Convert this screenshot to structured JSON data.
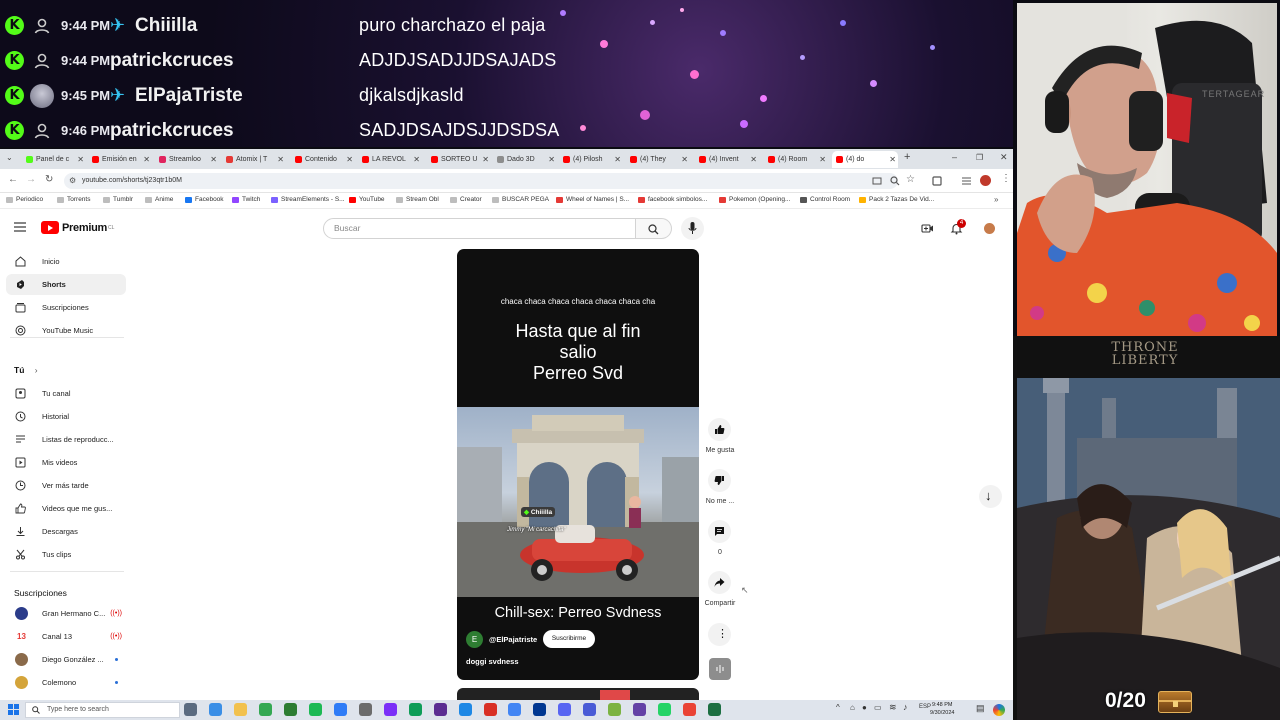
{
  "chat": {
    "messages": [
      {
        "time": "9:44 PM",
        "user": "Chiiilla",
        "message": "puro charchazo el paja",
        "has_sword": true,
        "avatar": "default"
      },
      {
        "time": "9:44 PM",
        "user": "patrickcruces",
        "message": "ADJDJSADJJDSAJADS",
        "has_sword": false,
        "avatar": "default"
      },
      {
        "time": "9:45 PM",
        "user": "ElPajaTriste",
        "message": "djkalsdjkasld",
        "has_sword": true,
        "avatar": "photo"
      },
      {
        "time": "9:46 PM",
        "user": "patrickcruces",
        "message": "SADJDSAJDSJJDSDSA",
        "has_sword": false,
        "avatar": "default"
      }
    ],
    "badge_glyph": "K",
    "sword_glyph": "✈"
  },
  "browser": {
    "tabs": [
      {
        "label": "Panel de c",
        "color": "#53fc18"
      },
      {
        "label": "Emisión en",
        "color": "#ff0000"
      },
      {
        "label": "Streamloo",
        "color": "#e0245e"
      },
      {
        "label": "Atomix | T",
        "color": "#e53935"
      },
      {
        "label": "Contenido",
        "color": "#ff0000"
      },
      {
        "label": "LA REVOL",
        "color": "#ff0000"
      },
      {
        "label": "SORTEO U",
        "color": "#ff0000"
      },
      {
        "label": "Dado 3D",
        "color": "#8d8d8d"
      },
      {
        "label": "(4) Pilosh",
        "color": "#ff0000"
      },
      {
        "label": "(4) They",
        "color": "#ff0000"
      },
      {
        "label": "(4) Invent",
        "color": "#ff0000"
      },
      {
        "label": "(4) Room",
        "color": "#ff0000"
      },
      {
        "label": "(4) do",
        "color": "#ff0000"
      }
    ],
    "url": "youtube.com/shorts/tj23qtr1b0M",
    "bookmarks": [
      "Periodico",
      "Torrents",
      "Tumblr",
      "Anime",
      "Facebook",
      "Twitch",
      "StreamElements - S...",
      "YouTube",
      "Stream Obl",
      "Creator",
      "BUSCAR PEGA",
      "Wheel of Names | S...",
      "facebook simbolos...",
      "Pokemon (Opening...",
      "Control Room",
      "Pack 2 Tazas De Vid..."
    ]
  },
  "youtube": {
    "logo_text": "Premium",
    "logo_sup": "CL",
    "search_placeholder": "Buscar",
    "notification_count": "4",
    "sidebar_main": [
      "Inicio",
      "Shorts",
      "Suscripciones",
      "YouTube Music"
    ],
    "you_header": "Tú",
    "sidebar_you": [
      "Tu canal",
      "Historial",
      "Listas de reproducc...",
      "Mis videos",
      "Ver más tarde",
      "Videos que me gus...",
      "Descargas",
      "Tus clips"
    ],
    "subs_header": "Suscripciones",
    "subscriptions": [
      {
        "name": "Gran Hermano C...",
        "status": "live"
      },
      {
        "name": "Canal 13",
        "status": "live"
      },
      {
        "name": "Diego González ...",
        "status": "new"
      },
      {
        "name": "Colemono",
        "status": "new"
      }
    ],
    "short": {
      "lyric": "chaca chaca chaca chaca chaca chaca cha",
      "title_lines": [
        "Hasta que al fin",
        "salio",
        "Perreo Svd"
      ],
      "song_name": "Chill-sex: Perreo Svdness",
      "channel_initial": "E",
      "channel": "@ElPajatriste",
      "subscribe": "Suscribirme",
      "description": "doggi svdness",
      "overlay_tag": "Chiiilla",
      "overlay_caption": "Jimmy \"Mi carcachita\""
    },
    "actions": {
      "like": "Me gusta",
      "dislike": "No me ...",
      "comments": "0",
      "share": "Compartir"
    }
  },
  "taskbar": {
    "search_placeholder": "Type here to search",
    "lang": "ESP",
    "time": "9:48 PM",
    "date": "9/30/2024"
  },
  "stream_overlay": {
    "game_logo_line1": "THRONE",
    "game_logo_line2": "LIBERTY",
    "counter": "0/20"
  }
}
